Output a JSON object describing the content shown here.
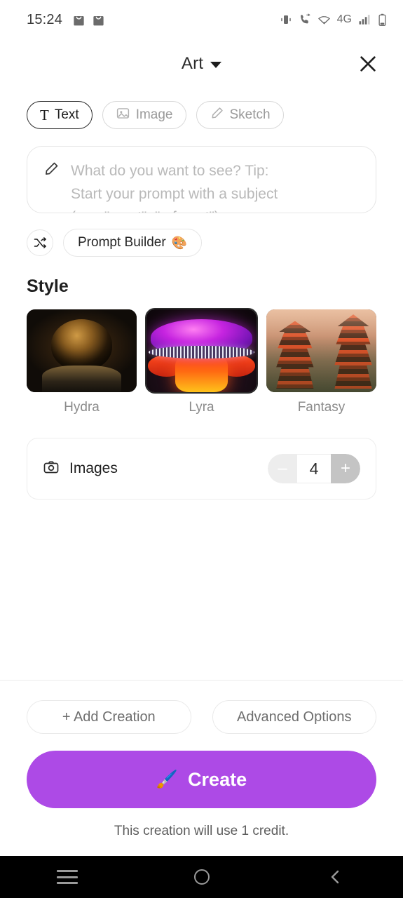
{
  "status_bar": {
    "time": "15:24",
    "left_icons": [
      "shopping-bag-icon",
      "shopping-bag-icon"
    ],
    "right_icons": [
      "vibrate-icon",
      "call-forward-icon",
      "wifi-icon",
      "signal-bars-icon",
      "battery-icon"
    ],
    "network_label": "4G"
  },
  "header": {
    "title": "Art",
    "dropdown_icon": "chevron-down-icon",
    "close_icon": "close-icon"
  },
  "modes": [
    {
      "label": "Text",
      "icon": "text-icon",
      "selected": true
    },
    {
      "label": "Image",
      "icon": "image-icon",
      "selected": false
    },
    {
      "label": "Sketch",
      "icon": "pencil-icon",
      "selected": false
    }
  ],
  "prompt": {
    "icon": "pencil-icon",
    "value": "",
    "placeholder": "What do you want to see? Tip:\nStart your prompt with a subject\n(e.g. \"a cat\", \"a forest\")"
  },
  "builder": {
    "shuffle_icon": "shuffle-icon",
    "label": "Prompt Builder",
    "emoji": "🎨"
  },
  "style": {
    "title": "Style",
    "items": [
      {
        "label": "Hydra",
        "selected": false
      },
      {
        "label": "Lyra",
        "selected": true
      },
      {
        "label": "Fantasy",
        "selected": false
      }
    ]
  },
  "images": {
    "icon": "camera-icon",
    "label": "Images",
    "value": "4",
    "decrement_label": "–",
    "increment_label": "+"
  },
  "footer": {
    "add_creation_label": "+ Add Creation",
    "advanced_options_label": "Advanced Options",
    "create_label": "Create",
    "create_emoji": "🖌️",
    "credit_note": "This creation will use 1 credit."
  },
  "nav_bar": {
    "recents_icon": "menu-icon",
    "home_icon": "circle-icon",
    "back_icon": "chevron-left-icon"
  },
  "colors": {
    "accent": "#ad4ae6",
    "text_primary": "#1f1f1f",
    "text_muted": "#8b8b8b",
    "border": "#e6e6e6"
  }
}
